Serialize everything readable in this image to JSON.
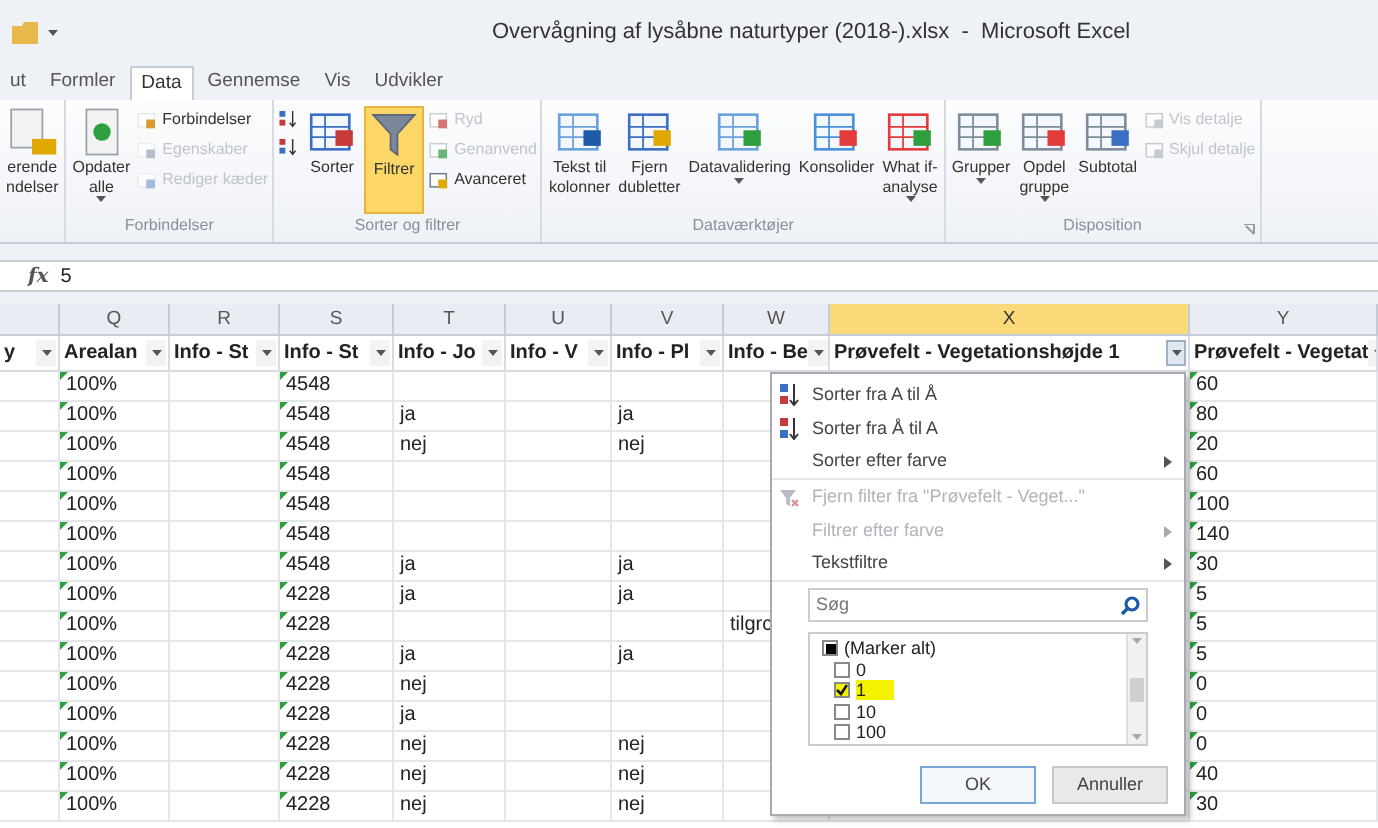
{
  "window": {
    "title": "Overvågning af lysåbne naturtyper (2018-).xlsx  -  Microsoft Excel"
  },
  "tabs": [
    {
      "label": "ut",
      "selected": false
    },
    {
      "label": "Formler",
      "selected": false
    },
    {
      "label": "Data",
      "selected": true
    },
    {
      "label": "Gennemse",
      "selected": false
    },
    {
      "label": "Vis",
      "selected": false
    },
    {
      "label": "Udvikler",
      "selected": false
    }
  ],
  "ribbon": {
    "groups": [
      {
        "items": [
          {
            "kind": "large",
            "lines": [
              "erende",
              "ndelser"
            ],
            "menu": false,
            "disabled": false,
            "selected": false
          }
        ]
      },
      {
        "label": "Forbindelser",
        "items": [
          {
            "kind": "large",
            "lines": [
              "Opdater",
              "alle"
            ],
            "menu": true,
            "disabled": false,
            "selected": false
          },
          {
            "kind": "stack",
            "children": [
              {
                "label": "Forbindelser",
                "disabled": false
              },
              {
                "label": "Egenskaber",
                "disabled": true
              },
              {
                "label": "Rediger kæder",
                "disabled": true
              }
            ]
          }
        ]
      },
      {
        "label": "Sorter og filtrer",
        "items": [
          {
            "kind": "stack",
            "children": [
              {
                "disabled": false
              },
              {
                "disabled": false
              }
            ]
          },
          {
            "kind": "large",
            "lines": [
              "Sorter"
            ],
            "menu": false,
            "disabled": false,
            "selected": false
          },
          {
            "kind": "large",
            "lines": [
              "Filtrer"
            ],
            "menu": false,
            "disabled": false,
            "selected": true
          },
          {
            "kind": "stack",
            "children": [
              {
                "label": "Ryd",
                "disabled": true
              },
              {
                "label": "Genanvend",
                "disabled": true
              },
              {
                "label": "Avanceret",
                "disabled": false
              }
            ]
          }
        ]
      },
      {
        "label": "Dataværktøjer",
        "items": [
          {
            "kind": "large",
            "lines": [
              "Tekst til",
              "kolonner"
            ],
            "menu": false,
            "disabled": false,
            "selected": false
          },
          {
            "kind": "large",
            "lines": [
              "Fjern",
              "dubletter"
            ],
            "menu": false,
            "disabled": false,
            "selected": false
          },
          {
            "kind": "large",
            "lines": [
              "Datavalidering"
            ],
            "menu": true,
            "disabled": false,
            "selected": false
          },
          {
            "kind": "large",
            "lines": [
              "Konsolider"
            ],
            "menu": false,
            "disabled": false,
            "selected": false
          },
          {
            "kind": "large",
            "lines": [
              "What if-",
              "analyse"
            ],
            "menu": true,
            "disabled": false,
            "selected": false
          }
        ]
      },
      {
        "label": "Disposition",
        "launcher": true,
        "items": [
          {
            "kind": "large",
            "lines": [
              "Grupper"
            ],
            "menu": true,
            "disabled": false,
            "selected": false
          },
          {
            "kind": "large",
            "lines": [
              "Opdel",
              "gruppe"
            ],
            "menu": true,
            "disabled": false,
            "selected": false
          },
          {
            "kind": "large",
            "lines": [
              "Subtotal"
            ],
            "menu": false,
            "disabled": false,
            "selected": false
          },
          {
            "kind": "stack",
            "children": [
              {
                "label": "Vis detalje",
                "disabled": true
              },
              {
                "label": "Skjul detalje",
                "disabled": true
              }
            ]
          }
        ]
      }
    ]
  },
  "formula_bar": {
    "function_label": "fx",
    "value": "5"
  },
  "sheet": {
    "columns": [
      {
        "header": "y",
        "selected": false
      },
      {
        "letter": "Q",
        "header": "Arealan",
        "selected": false,
        "text_numbers": true
      },
      {
        "letter": "R",
        "header": "Info - St",
        "selected": false
      },
      {
        "letter": "S",
        "header": "Info - St",
        "selected": false,
        "text_numbers": true
      },
      {
        "letter": "T",
        "header": "Info - Jo",
        "selected": false
      },
      {
        "letter": "U",
        "header": "Info - V",
        "selected": false
      },
      {
        "letter": "V",
        "header": "Info - Pl",
        "selected": false
      },
      {
        "letter": "W",
        "header": "Info - Be",
        "selected": false
      },
      {
        "letter": "X",
        "header": "Prøvefelt - Vegetationshøjde 1",
        "selected": true
      },
      {
        "letter": "Y",
        "header": "Prøvefelt - Vegetat",
        "selected": false,
        "text_numbers": true
      }
    ],
    "rows": [
      [
        null,
        "100%",
        null,
        "4548",
        null,
        null,
        null,
        null,
        null,
        "60"
      ],
      [
        null,
        "100%",
        null,
        "4548",
        "ja",
        null,
        "ja",
        null,
        null,
        "80"
      ],
      [
        null,
        "100%",
        null,
        "4548",
        "nej",
        null,
        "nej",
        null,
        null,
        "20"
      ],
      [
        null,
        "100%",
        null,
        "4548",
        null,
        null,
        null,
        null,
        null,
        "60"
      ],
      [
        null,
        "100%",
        null,
        "4548",
        null,
        null,
        null,
        null,
        null,
        "100"
      ],
      [
        null,
        "100%",
        null,
        "4548",
        null,
        null,
        null,
        null,
        null,
        "140"
      ],
      [
        null,
        "100%",
        null,
        "4548",
        "ja",
        null,
        "ja",
        null,
        null,
        "30"
      ],
      [
        null,
        "100%",
        null,
        "4228",
        "ja",
        null,
        "ja",
        null,
        null,
        "5"
      ],
      [
        null,
        "100%",
        null,
        "4228",
        null,
        null,
        null,
        "tilgrc",
        null,
        "5"
      ],
      [
        null,
        "100%",
        null,
        "4228",
        "ja",
        null,
        "ja",
        null,
        null,
        "5"
      ],
      [
        null,
        "100%",
        null,
        "4228",
        "nej",
        null,
        null,
        null,
        null,
        "0"
      ],
      [
        null,
        "100%",
        null,
        "4228",
        "ja",
        null,
        null,
        null,
        null,
        "0"
      ],
      [
        null,
        "100%",
        null,
        "4228",
        "nej",
        null,
        "nej",
        null,
        null,
        "0"
      ],
      [
        null,
        "100%",
        null,
        "4228",
        "nej",
        null,
        "nej",
        null,
        null,
        "40"
      ],
      [
        null,
        "100%",
        null,
        "4228",
        "nej",
        null,
        "nej",
        null,
        null,
        "30"
      ]
    ]
  },
  "filter_menu": {
    "items": [
      {
        "label": "Sorter fra A til Å",
        "kind": "sort-asc",
        "disabled": false,
        "submenu": false
      },
      {
        "label": "Sorter fra Å til A",
        "kind": "sort-desc",
        "disabled": false,
        "submenu": false
      },
      {
        "label": "Sorter efter farve",
        "kind": "plain",
        "disabled": false,
        "submenu": true
      },
      {
        "label": "Fjern filter fra \"Prøvefelt - Veget...\"",
        "kind": "clear-filter",
        "disabled": true,
        "submenu": false
      },
      {
        "label": "Filtrer efter farve",
        "kind": "plain",
        "disabled": true,
        "submenu": true
      },
      {
        "label": "Tekstfiltre",
        "kind": "plain",
        "disabled": false,
        "submenu": true
      }
    ],
    "search": {
      "placeholder": "Søg"
    },
    "values": [
      {
        "label": "(Marker alt)",
        "checked": false,
        "mixed": true,
        "highlighted": false
      },
      {
        "label": "0",
        "checked": false,
        "mixed": false,
        "highlighted": false
      },
      {
        "label": "1",
        "checked": true,
        "mixed": false,
        "highlighted": true
      },
      {
        "label": "10",
        "checked": false,
        "mixed": false,
        "highlighted": false
      },
      {
        "label": "100",
        "checked": false,
        "mixed": false,
        "highlighted": false
      }
    ],
    "buttons": [
      "OK",
      "Annuller"
    ]
  }
}
